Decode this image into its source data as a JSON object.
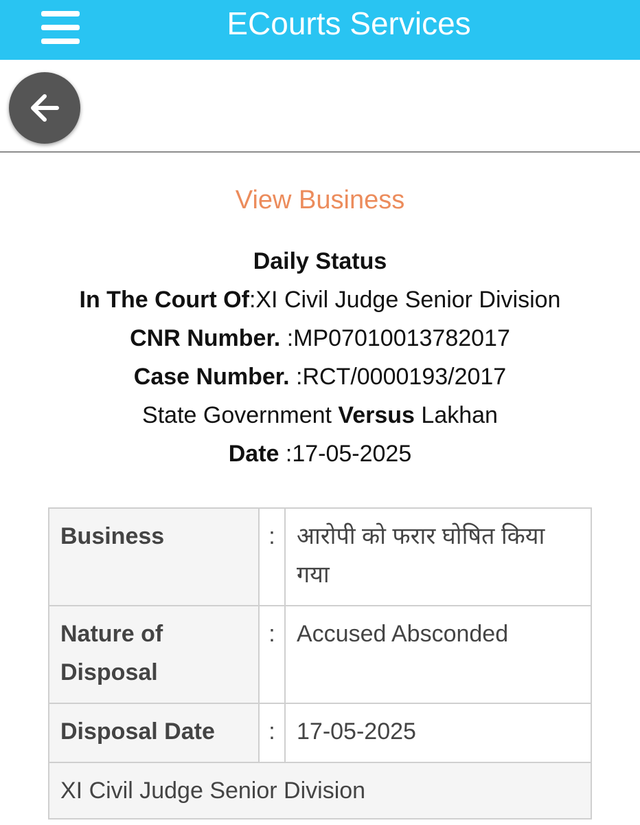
{
  "header": {
    "title": "ECourts Services"
  },
  "page": {
    "heading": "View Business"
  },
  "status": {
    "title": "Daily Status",
    "court_label": "In The Court Of",
    "court_value": ":XI Civil Judge Senior Division",
    "cnr_label": "CNR Number.",
    "cnr_value": ":MP07010013782017",
    "case_label": "Case Number.",
    "case_value": ":RCT/0000193/2017",
    "petitioner": "State Government",
    "versus": "Versus",
    "respondent": "Lakhan",
    "date_label": "Date",
    "date_value": ":17-05-2025"
  },
  "table": {
    "rows": [
      {
        "label": "Business",
        "colon": ":",
        "value": "आरोपी को फरार घोषित किया गया"
      },
      {
        "label": "Nature of Disposal",
        "colon": ":",
        "value": "Accused Absconded"
      },
      {
        "label": "Disposal Date",
        "colon": ":",
        "value": "17-05-2025"
      }
    ],
    "footer": "XI Civil Judge Senior Division"
  },
  "colors": {
    "topbar": "#29c4f2",
    "heading": "#ec8c5c",
    "back_button": "#555555"
  },
  "icons": {
    "menu": "hamburger-menu-icon",
    "back": "arrow-left-icon"
  }
}
